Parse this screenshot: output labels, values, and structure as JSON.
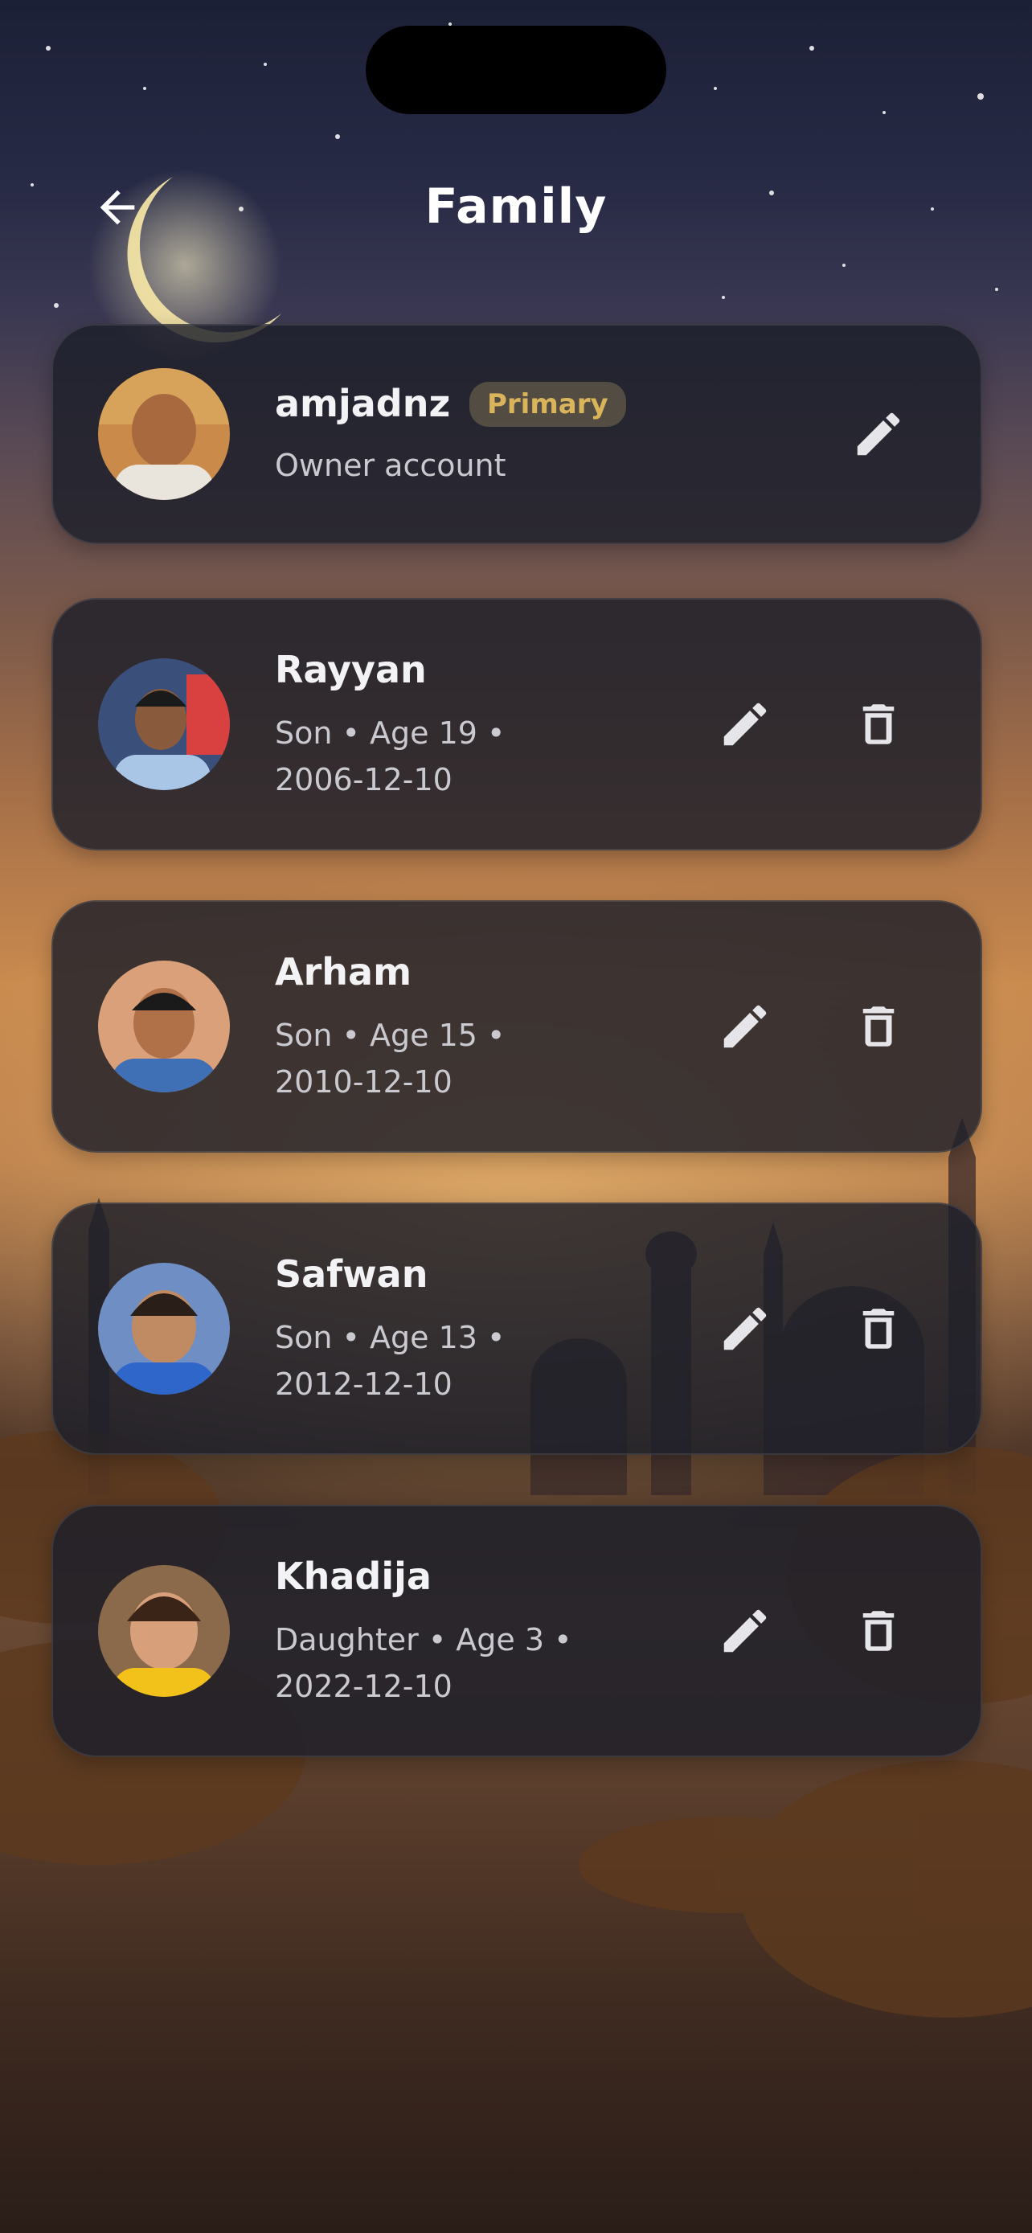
{
  "header": {
    "title": "Family"
  },
  "owner": {
    "name": "amjadnz",
    "badge": "Primary",
    "subtitle": "Owner account"
  },
  "members": [
    {
      "name": "Rayyan",
      "line1": "Son • Age 19 •",
      "line2": "2006-12-10"
    },
    {
      "name": "Arham",
      "line1": "Son • Age 15 •",
      "line2": "2010-12-10"
    },
    {
      "name": "Safwan",
      "line1": "Son • Age 13 •",
      "line2": "2012-12-10"
    },
    {
      "name": "Khadija",
      "line1": "Daughter • Age 3 •",
      "line2": "2022-12-10"
    }
  ],
  "icons": {
    "back": "arrow-left-icon",
    "edit": "pencil-icon",
    "delete": "trash-icon"
  },
  "colors": {
    "badge_text": "#d9b45a",
    "card_bg": "#1c1e2a",
    "subtitle": "#c9c9cf"
  }
}
